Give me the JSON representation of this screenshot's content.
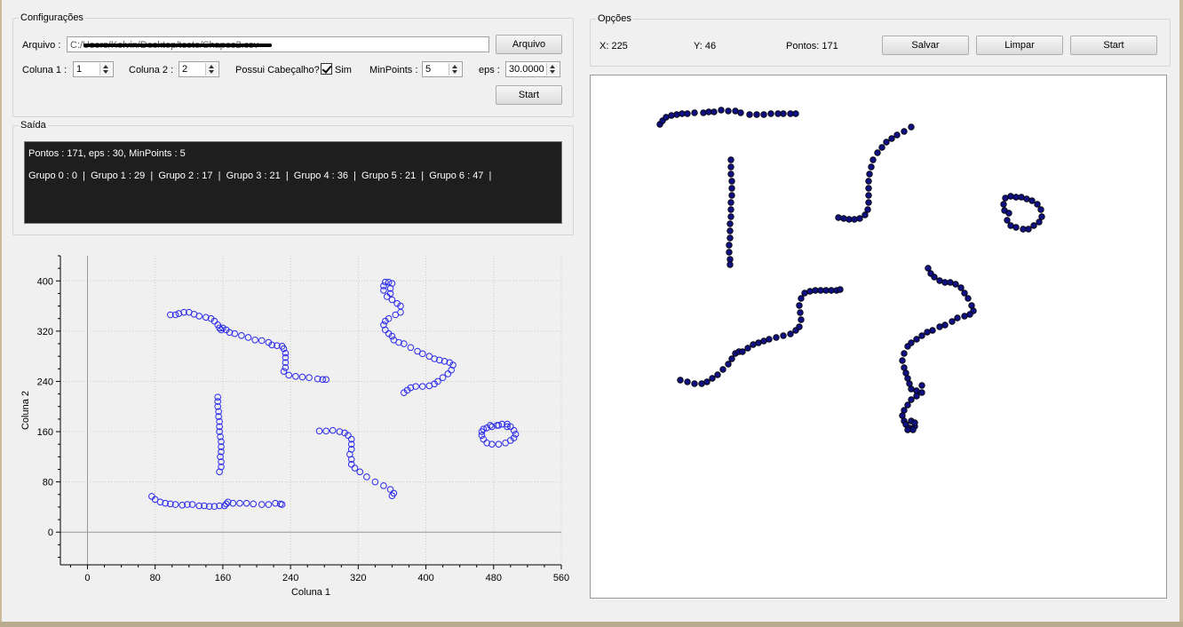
{
  "config": {
    "title": "Configurações",
    "arquivo_label": "Arquivo :",
    "arquivo_value": "C:/Users/Kelvin/Desktop/teste/Shapes2.csv",
    "arquivo_button": "Arquivo",
    "coluna1_label": "Coluna 1 :",
    "coluna1_value": "1",
    "coluna2_label": "Coluna 2 :",
    "coluna2_value": "2",
    "cabecalho_label": "Possui Cabeçalho?",
    "cabecalho_checked": true,
    "cabecalho_option": "Sim",
    "minpoints_label": "MinPoints :",
    "minpoints_value": "5",
    "eps_label": "eps :",
    "eps_value": "30.0000",
    "start_button": "Start"
  },
  "output": {
    "title": "Saída",
    "line1": "Pontos : 171, eps : 30, MinPoints : 5",
    "line2": "Grupo 0 : 0  |  Grupo 1 : 29  |  Grupo 2 : 17  |  Grupo 3 : 21  |  Grupo 4 : 36  |  Grupo 5 : 21  |  Grupo 6 : 47  |"
  },
  "options": {
    "title": "Opções",
    "x_readout": "X: 225",
    "y_readout": "Y: 46",
    "pontos_readout": "Pontos: 171",
    "salvar_button": "Salvar",
    "limpar_button": "Limpar",
    "start_button": "Start"
  },
  "colors": {
    "scatter_marker": "#2a2aee",
    "canvas_marker_fill": "#101080",
    "console_bg": "#1e1e1e"
  },
  "chart_data": {
    "type": "scatter",
    "xlabel": "Coluna 1",
    "ylabel": "Coluna 2",
    "xlim": [
      -32,
      560
    ],
    "ylim": [
      -52,
      440
    ],
    "xticks": [
      0,
      80,
      160,
      240,
      320,
      400,
      480,
      560
    ],
    "yticks": [
      0,
      80,
      160,
      240,
      320,
      400
    ],
    "grid": true,
    "series": [
      {
        "points": [
          [
            98,
            346
          ],
          [
            104,
            346
          ],
          [
            108,
            348
          ],
          [
            114,
            350
          ],
          [
            120,
            350
          ],
          [
            126,
            347
          ],
          [
            132,
            344
          ],
          [
            140,
            342
          ],
          [
            146,
            340
          ],
          [
            150,
            336
          ],
          [
            154,
            330
          ],
          [
            156,
            325
          ],
          [
            158,
            322
          ],
          [
            160,
            325
          ],
          [
            164,
            322
          ],
          [
            168,
            318
          ],
          [
            174,
            316
          ],
          [
            182,
            313
          ],
          [
            190,
            310
          ],
          [
            198,
            306
          ],
          [
            206,
            305
          ],
          [
            214,
            302
          ],
          [
            218,
            298
          ],
          [
            224,
            297
          ],
          [
            230,
            296
          ],
          [
            232,
            292
          ],
          [
            234,
            285
          ],
          [
            234,
            278
          ],
          [
            234,
            270
          ],
          [
            234,
            262
          ],
          [
            232,
            256
          ],
          [
            238,
            250
          ],
          [
            246,
            248
          ],
          [
            254,
            247
          ],
          [
            262,
            246
          ],
          [
            272,
            244
          ],
          [
            278,
            243
          ],
          [
            282,
            243
          ],
          [
            154,
            215
          ],
          [
            154,
            208
          ],
          [
            154,
            200
          ],
          [
            155,
            192
          ],
          [
            155,
            184
          ],
          [
            156,
            176
          ],
          [
            156,
            168
          ],
          [
            156,
            160
          ],
          [
            157,
            152
          ],
          [
            158,
            144
          ],
          [
            158,
            136
          ],
          [
            158,
            128
          ],
          [
            157,
            120
          ],
          [
            158,
            112
          ],
          [
            158,
            104
          ],
          [
            156,
            96
          ],
          [
            76,
            57
          ],
          [
            80,
            52
          ],
          [
            86,
            48
          ],
          [
            92,
            46
          ],
          [
            98,
            45
          ],
          [
            104,
            44
          ],
          [
            112,
            43
          ],
          [
            118,
            44
          ],
          [
            124,
            44
          ],
          [
            132,
            42
          ],
          [
            138,
            42
          ],
          [
            144,
            41
          ],
          [
            150,
            41
          ],
          [
            156,
            42
          ],
          [
            162,
            42
          ],
          [
            164,
            45
          ],
          [
            166,
            48
          ],
          [
            172,
            46
          ],
          [
            180,
            46
          ],
          [
            188,
            46
          ],
          [
            196,
            45
          ],
          [
            206,
            44
          ],
          [
            214,
            44
          ],
          [
            222,
            46
          ],
          [
            228,
            45
          ],
          [
            230,
            44
          ],
          [
            350,
            385
          ],
          [
            350,
            392
          ],
          [
            352,
            398
          ],
          [
            356,
            398
          ],
          [
            360,
            396
          ],
          [
            358,
            388
          ],
          [
            358,
            380
          ],
          [
            354,
            375
          ],
          [
            360,
            370
          ],
          [
            366,
            364
          ],
          [
            370,
            360
          ],
          [
            370,
            350
          ],
          [
            364,
            346
          ],
          [
            356,
            340
          ],
          [
            352,
            336
          ],
          [
            350,
            330
          ],
          [
            352,
            322
          ],
          [
            356,
            316
          ],
          [
            360,
            312
          ],
          [
            362,
            306
          ],
          [
            368,
            302
          ],
          [
            374,
            300
          ],
          [
            382,
            294
          ],
          [
            390,
            288
          ],
          [
            396,
            284
          ],
          [
            404,
            280
          ],
          [
            410,
            276
          ],
          [
            416,
            274
          ],
          [
            422,
            272
          ],
          [
            428,
            270
          ],
          [
            432,
            266
          ],
          [
            430,
            258
          ],
          [
            426,
            252
          ],
          [
            420,
            246
          ],
          [
            414,
            240
          ],
          [
            410,
            236
          ],
          [
            404,
            233
          ],
          [
            396,
            232
          ],
          [
            388,
            232
          ],
          [
            382,
            230
          ],
          [
            378,
            226
          ],
          [
            374,
            222
          ],
          [
            274,
            161
          ],
          [
            282,
            161
          ],
          [
            290,
            162
          ],
          [
            298,
            160
          ],
          [
            304,
            158
          ],
          [
            308,
            154
          ],
          [
            312,
            148
          ],
          [
            312,
            140
          ],
          [
            312,
            132
          ],
          [
            310,
            124
          ],
          [
            312,
            116
          ],
          [
            312,
            108
          ],
          [
            316,
            102
          ],
          [
            322,
            96
          ],
          [
            330,
            88
          ],
          [
            340,
            80
          ],
          [
            350,
            74
          ],
          [
            358,
            68
          ],
          [
            362,
            62
          ],
          [
            360,
            58
          ],
          [
            472,
            166
          ],
          [
            478,
            168
          ],
          [
            484,
            170
          ],
          [
            490,
            172
          ],
          [
            496,
            172
          ],
          [
            500,
            168
          ],
          [
            504,
            162
          ],
          [
            506,
            156
          ],
          [
            504,
            150
          ],
          [
            500,
            146
          ],
          [
            494,
            142
          ],
          [
            486,
            140
          ],
          [
            478,
            140
          ],
          [
            472,
            142
          ],
          [
            468,
            148
          ],
          [
            466,
            154
          ],
          [
            466,
            160
          ],
          [
            468,
            164
          ],
          [
            476,
            170
          ],
          [
            486,
            170
          ],
          [
            496,
            168
          ]
        ]
      }
    ]
  },
  "canvas_points": [
    [
      741,
      140
    ],
    [
      744,
      136
    ],
    [
      748,
      132
    ],
    [
      754,
      130
    ],
    [
      760,
      129
    ],
    [
      766,
      128
    ],
    [
      772,
      128
    ],
    [
      780,
      127
    ],
    [
      790,
      127
    ],
    [
      796,
      126
    ],
    [
      802,
      126
    ],
    [
      810,
      124
    ],
    [
      818,
      125
    ],
    [
      826,
      125
    ],
    [
      832,
      127
    ],
    [
      842,
      129
    ],
    [
      850,
      129
    ],
    [
      858,
      129
    ],
    [
      866,
      128
    ],
    [
      874,
      128
    ],
    [
      880,
      128
    ],
    [
      888,
      128
    ],
    [
      894,
      128
    ],
    [
      821,
      180
    ],
    [
      821,
      188
    ],
    [
      821,
      196
    ],
    [
      822,
      204
    ],
    [
      822,
      212
    ],
    [
      822,
      220
    ],
    [
      821,
      228
    ],
    [
      821,
      236
    ],
    [
      821,
      244
    ],
    [
      820,
      252
    ],
    [
      820,
      260
    ],
    [
      820,
      268
    ],
    [
      819,
      276
    ],
    [
      819,
      284
    ],
    [
      820,
      292
    ],
    [
      820,
      298
    ],
    [
      942,
      245
    ],
    [
      948,
      246
    ],
    [
      954,
      247
    ],
    [
      960,
      247
    ],
    [
      966,
      246
    ],
    [
      972,
      242
    ],
    [
      975,
      236
    ],
    [
      976,
      228
    ],
    [
      976,
      220
    ],
    [
      976,
      212
    ],
    [
      976,
      204
    ],
    [
      977,
      196
    ],
    [
      979,
      188
    ],
    [
      981,
      180
    ],
    [
      986,
      172
    ],
    [
      991,
      166
    ],
    [
      996,
      160
    ],
    [
      1002,
      156
    ],
    [
      1008,
      152
    ],
    [
      1016,
      148
    ],
    [
      1024,
      143
    ],
    [
      1129,
      237
    ],
    [
      1128,
      230
    ],
    [
      1130,
      223
    ],
    [
      1136,
      221
    ],
    [
      1142,
      222
    ],
    [
      1148,
      222
    ],
    [
      1154,
      224
    ],
    [
      1160,
      226
    ],
    [
      1166,
      230
    ],
    [
      1170,
      236
    ],
    [
      1171,
      244
    ],
    [
      1168,
      250
    ],
    [
      1162,
      254
    ],
    [
      1156,
      258
    ],
    [
      1150,
      258
    ],
    [
      1142,
      256
    ],
    [
      1136,
      254
    ],
    [
      1132,
      248
    ],
    [
      1134,
      240
    ],
    [
      764,
      428
    ],
    [
      772,
      430
    ],
    [
      780,
      432
    ],
    [
      788,
      432
    ],
    [
      794,
      430
    ],
    [
      800,
      426
    ],
    [
      806,
      422
    ],
    [
      812,
      416
    ],
    [
      818,
      410
    ],
    [
      822,
      404
    ],
    [
      826,
      398
    ],
    [
      830,
      396
    ],
    [
      834,
      396
    ],
    [
      840,
      392
    ],
    [
      846,
      388
    ],
    [
      852,
      386
    ],
    [
      858,
      384
    ],
    [
      864,
      382
    ],
    [
      872,
      380
    ],
    [
      880,
      378
    ],
    [
      888,
      376
    ],
    [
      894,
      372
    ],
    [
      898,
      368
    ],
    [
      900,
      360
    ],
    [
      899,
      352
    ],
    [
      898,
      344
    ],
    [
      900,
      336
    ],
    [
      904,
      330
    ],
    [
      910,
      328
    ],
    [
      916,
      327
    ],
    [
      922,
      327
    ],
    [
      928,
      327
    ],
    [
      934,
      327
    ],
    [
      940,
      327
    ],
    [
      944,
      326
    ],
    [
      1043,
      302
    ],
    [
      1046,
      308
    ],
    [
      1050,
      312
    ],
    [
      1056,
      316
    ],
    [
      1062,
      318
    ],
    [
      1068,
      318
    ],
    [
      1074,
      320
    ],
    [
      1080,
      324
    ],
    [
      1084,
      330
    ],
    [
      1088,
      336
    ],
    [
      1092,
      344
    ],
    [
      1094,
      350
    ],
    [
      1090,
      354
    ],
    [
      1084,
      356
    ],
    [
      1076,
      358
    ],
    [
      1070,
      362
    ],
    [
      1062,
      366
    ],
    [
      1056,
      368
    ],
    [
      1048,
      372
    ],
    [
      1042,
      374
    ],
    [
      1036,
      378
    ],
    [
      1030,
      382
    ],
    [
      1024,
      386
    ],
    [
      1020,
      390
    ],
    [
      1016,
      398
    ],
    [
      1014,
      406
    ],
    [
      1016,
      414
    ],
    [
      1018,
      420
    ],
    [
      1020,
      426
    ],
    [
      1022,
      432
    ],
    [
      1024,
      438
    ],
    [
      1030,
      440
    ],
    [
      1036,
      434
    ],
    [
      1036,
      442
    ],
    [
      1030,
      446
    ],
    [
      1024,
      450
    ],
    [
      1020,
      456
    ],
    [
      1016,
      462
    ],
    [
      1014,
      468
    ],
    [
      1016,
      474
    ],
    [
      1018,
      478
    ],
    [
      1022,
      482
    ],
    [
      1028,
      480
    ],
    [
      1026,
      484
    ],
    [
      1020,
      484
    ],
    [
      1024,
      474
    ],
    [
      1028,
      476
    ]
  ]
}
